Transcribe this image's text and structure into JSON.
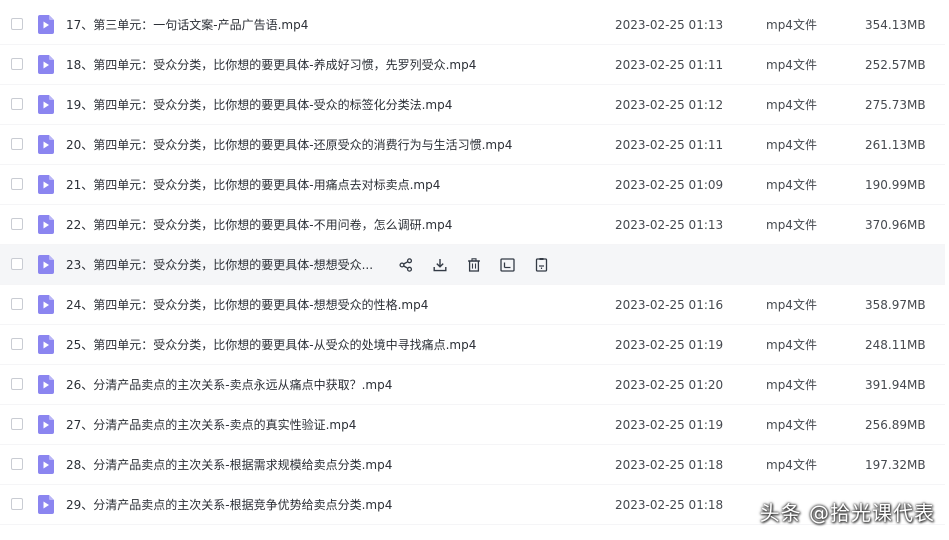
{
  "files": [
    {
      "name": "17、第三单元：一句话文案-产品广告语.mp4",
      "date": "2023-02-25 01:13",
      "type": "mp4文件",
      "size": "354.13MB"
    },
    {
      "name": "18、第四单元：受众分类，比你想的要更具体-养成好习惯，先罗列受众.mp4",
      "date": "2023-02-25 01:11",
      "type": "mp4文件",
      "size": "252.57MB"
    },
    {
      "name": "19、第四单元：受众分类，比你想的要更具体-受众的标签化分类法.mp4",
      "date": "2023-02-25 01:12",
      "type": "mp4文件",
      "size": "275.73MB"
    },
    {
      "name": "20、第四单元：受众分类，比你想的要更具体-还原受众的消费行为与生活习惯.mp4",
      "date": "2023-02-25 01:11",
      "type": "mp4文件",
      "size": "261.13MB"
    },
    {
      "name": "21、第四单元：受众分类，比你想的要更具体-用痛点去对标卖点.mp4",
      "date": "2023-02-25 01:09",
      "type": "mp4文件",
      "size": "190.99MB"
    },
    {
      "name": "22、第四单元：受众分类，比你想的要更具体-不用问卷，怎么调研.mp4",
      "date": "2023-02-25 01:13",
      "type": "mp4文件",
      "size": "370.96MB"
    },
    {
      "name": "23、第四单元：受众分类，比你想的要更具体-想想受众...",
      "date": "",
      "type": "",
      "size": ""
    },
    {
      "name": "24、第四单元：受众分类，比你想的要更具体-想想受众的性格.mp4",
      "date": "2023-02-25 01:16",
      "type": "mp4文件",
      "size": "358.97MB"
    },
    {
      "name": "25、第四单元：受众分类，比你想的要更具体-从受众的处境中寻找痛点.mp4",
      "date": "2023-02-25 01:19",
      "type": "mp4文件",
      "size": "248.11MB"
    },
    {
      "name": "26、分清产品卖点的主次关系-卖点永远从痛点中获取？.mp4",
      "date": "2023-02-25 01:20",
      "type": "mp4文件",
      "size": "391.94MB"
    },
    {
      "name": "27、分清产品卖点的主次关系-卖点的真实性验证.mp4",
      "date": "2023-02-25 01:19",
      "type": "mp4文件",
      "size": "256.89MB"
    },
    {
      "name": "28、分清产品卖点的主次关系-根据需求规模给卖点分类.mp4",
      "date": "2023-02-25 01:18",
      "type": "mp4文件",
      "size": "197.32MB"
    },
    {
      "name": "29、分清产品卖点的主次关系-根据竞争优势给卖点分类.mp4",
      "date": "2023-02-25 01:18",
      "type": "",
      "size": ""
    }
  ],
  "hovered_row_index": 6,
  "hover_actions": [
    "share-icon",
    "download-icon",
    "delete-icon",
    "rename-icon",
    "copy-icon"
  ],
  "watermark": "头条 @拾光课代表",
  "colors": {
    "file_icon": "#8b85f0",
    "file_icon_fold": "#b9b5f7",
    "hover_row_bg": "#f5f6f8",
    "action_icon": "#333a45"
  }
}
